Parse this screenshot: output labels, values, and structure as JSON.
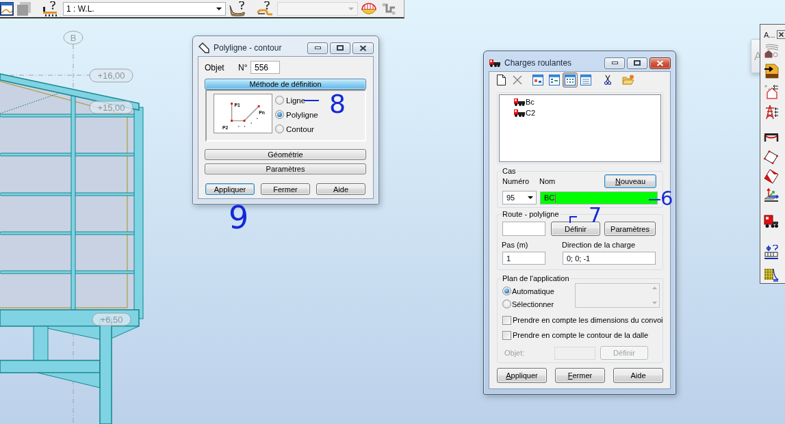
{
  "top_toolbar": {
    "load_case_combo": {
      "value": "1 : W.L."
    },
    "secondary_combo": {
      "disabled": true
    }
  },
  "drawing": {
    "axis_label": "B",
    "levels": [
      "+16,00",
      "+15,00",
      "+6,50"
    ]
  },
  "polyline_dialog": {
    "title": "Polyligne - contour",
    "active": false,
    "object_label": "Objet",
    "number_label": "N°",
    "number_value": "556",
    "sections": [
      {
        "label": "Méthode de définition",
        "expanded": true
      },
      {
        "label": "Géométrie",
        "expanded": false
      },
      {
        "label": "Paramètres",
        "expanded": false
      }
    ],
    "diagram_labels": [
      "P1",
      "Pn",
      "P2"
    ],
    "methods": [
      {
        "label": "Ligne",
        "selected": false
      },
      {
        "label": "Polyligne",
        "selected": true
      },
      {
        "label": "Contour",
        "selected": false
      }
    ],
    "buttons": [
      {
        "label": "Appliquer",
        "focused": true
      },
      {
        "label": "Fermer",
        "focused": false
      },
      {
        "label": "Aide",
        "focused": false
      }
    ]
  },
  "rolling_loads_dialog": {
    "title": "Charges roulantes",
    "active": true,
    "tools": [
      {
        "kind": "new",
        "selected": false
      },
      {
        "kind": "delete",
        "selected": false
      },
      {
        "kind": "view-large",
        "selected": false
      },
      {
        "kind": "view-small",
        "selected": false
      },
      {
        "kind": "view-list",
        "selected": true
      },
      {
        "kind": "view-details",
        "selected": false
      },
      {
        "kind": "cut",
        "selected": false
      },
      {
        "kind": "open",
        "selected": false
      }
    ],
    "tree": [
      {
        "label": "Bc"
      },
      {
        "label": "C2"
      }
    ],
    "case": {
      "title": "Cas",
      "number_label": "Numéro",
      "name_label": "Nom",
      "new_button": {
        "label": "Nouveau",
        "mnemonic": true,
        "focused": true
      },
      "number_value": "95",
      "name_value": "BC",
      "name_highlighted": true,
      "name_focused": true
    },
    "route": {
      "title": "Route - polyligne",
      "define_button": "Définir",
      "parameters_button": "Paramètres",
      "step_label": "Pas (m)",
      "step_value": "1",
      "direction_label": "Direction de la charge",
      "direction_value": "0; 0; -1"
    },
    "plane": {
      "title": "Plan de l'application",
      "options": [
        {
          "label": "Automatique",
          "selected": true
        },
        {
          "label": "Sélectionner",
          "selected": false
        }
      ],
      "list_disabled": true,
      "checks": [
        {
          "label": "Prendre en compte les dimensions du convoi",
          "checked": false
        },
        {
          "label": "Prendre en compte le contour de la dalle",
          "checked": false
        }
      ],
      "object_label": "Objet:",
      "object_define_button": "Définir",
      "object_disabled": true
    },
    "buttons": [
      {
        "label": "Appliquer",
        "mnemonic": true
      },
      {
        "label": "Fermer",
        "mnemonic": true
      },
      {
        "label": "Aide",
        "mnemonic": false
      }
    ]
  },
  "tool_palette": {
    "title": "A...",
    "tools": [
      {
        "kind": "wind"
      },
      {
        "kind": "cfd"
      },
      {
        "kind": "snow"
      },
      {
        "kind": "pylon"
      },
      {
        "kind": "beam"
      },
      {
        "kind": "plate"
      },
      {
        "kind": "panel"
      },
      {
        "kind": "axes"
      },
      {
        "kind": "truck"
      },
      {
        "kind": "load"
      },
      {
        "kind": "hatch"
      }
    ]
  },
  "background_panel": {
    "label": "A"
  },
  "annotations": [
    {
      "kind": "dash",
      "text": "8"
    },
    {
      "kind": "none",
      "text": "9"
    },
    {
      "kind": "dash",
      "text": "6"
    },
    {
      "kind": "bracket",
      "text": "7"
    }
  ]
}
